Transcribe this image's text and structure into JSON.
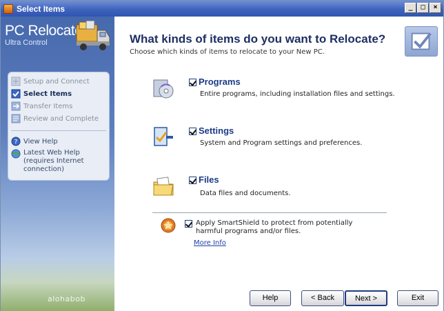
{
  "window": {
    "title": "Select Items",
    "controls": {
      "minimize": "_",
      "maximize": "□",
      "close": "×"
    }
  },
  "sidebar": {
    "logo_title": "PC Relocator",
    "logo_subtitle": "Ultra Control",
    "steps": [
      {
        "label": "Setup and Connect",
        "state": "done"
      },
      {
        "label": "Select Items",
        "state": "active"
      },
      {
        "label": "Transfer Items",
        "state": "pending"
      },
      {
        "label": "Review and Complete",
        "state": "pending"
      }
    ],
    "links": [
      {
        "label": "View Help"
      },
      {
        "label": "Latest Web Help (requires Internet connection)"
      }
    ],
    "brand": "alohabob"
  },
  "main": {
    "heading": "What kinds of items do you want to Relocate?",
    "subheading": "Choose which kinds of items to relocate to your New PC.",
    "options": [
      {
        "title": "Programs",
        "description": "Entire programs, including installation files and settings.",
        "checked": true,
        "icon": "programs-icon"
      },
      {
        "title": "Settings",
        "description": "System and Program settings and preferences.",
        "checked": true,
        "icon": "settings-icon"
      },
      {
        "title": "Files",
        "description": "Data files and documents.",
        "checked": true,
        "icon": "files-icon"
      }
    ],
    "smartshield": {
      "text": "Apply SmartShield to protect from potentially harmful programs and/or files.",
      "checked": true,
      "more_info": "More Info"
    }
  },
  "buttons": {
    "help": "Help",
    "back": "< Back",
    "next": "Next >",
    "exit": "Exit"
  },
  "colors": {
    "accent": "#1b3a86",
    "titlebar": "#3f63bd",
    "sidebar": "#4669ad"
  }
}
